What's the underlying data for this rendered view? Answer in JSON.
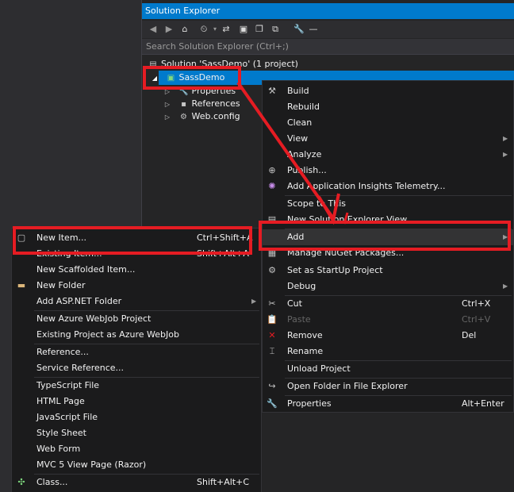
{
  "solution_explorer": {
    "title": "Solution Explorer",
    "search_placeholder": "Search Solution Explorer (Ctrl+;)",
    "toolbar_icons": [
      "back-icon",
      "forward-icon",
      "home-icon",
      "history-icon",
      "dropdown-icon",
      "sync-icon",
      "collapse-icon",
      "show-all-icon",
      "copy-icon",
      "wrench-icon",
      "pin-icon"
    ],
    "tree": {
      "solution": "Solution 'SassDemo' (1 project)",
      "project": "SassDemo",
      "children": [
        "Properties",
        "References",
        "Web.config"
      ]
    }
  },
  "context_menu": {
    "items": [
      {
        "label": "Build",
        "shortcut": "",
        "icon": "build-icon"
      },
      {
        "label": "Rebuild",
        "shortcut": "",
        "icon": ""
      },
      {
        "label": "Clean",
        "shortcut": "",
        "icon": ""
      },
      {
        "label": "View",
        "shortcut": "",
        "icon": "",
        "submenu": true
      },
      {
        "label": "Analyze",
        "shortcut": "",
        "icon": "",
        "submenu": true
      },
      {
        "label": "Publish...",
        "shortcut": "",
        "icon": "publish-icon"
      },
      {
        "label": "Add Application Insights Telemetry...",
        "shortcut": "",
        "icon": "insights-icon"
      },
      {
        "label": "Scope to This",
        "shortcut": "",
        "icon": ""
      },
      {
        "label": "New Solution Explorer View",
        "shortcut": "",
        "icon": "explorer-view-icon"
      },
      {
        "label": "Add",
        "shortcut": "",
        "icon": "",
        "submenu": true
      },
      {
        "label": "Manage NuGet Packages...",
        "shortcut": "",
        "icon": "nuget-icon"
      },
      {
        "label": "Set as StartUp Project",
        "shortcut": "",
        "icon": "gear-icon"
      },
      {
        "label": "Debug",
        "shortcut": "",
        "icon": "",
        "submenu": true
      },
      {
        "label": "Cut",
        "shortcut": "Ctrl+X",
        "icon": "cut-icon"
      },
      {
        "label": "Paste",
        "shortcut": "Ctrl+V",
        "icon": "paste-icon",
        "disabled": true
      },
      {
        "label": "Remove",
        "shortcut": "Del",
        "icon": "remove-icon"
      },
      {
        "label": "Rename",
        "shortcut": "",
        "icon": "rename-icon"
      },
      {
        "label": "Unload Project",
        "shortcut": "",
        "icon": ""
      },
      {
        "label": "Open Folder in File Explorer",
        "shortcut": "",
        "icon": "open-folder-icon"
      },
      {
        "label": "Properties",
        "shortcut": "Alt+Enter",
        "icon": "wrench-icon"
      }
    ]
  },
  "add_submenu": {
    "items": [
      {
        "label": "New Item...",
        "shortcut": "Ctrl+Shift+A",
        "icon": "new-item-icon"
      },
      {
        "label": "Existing Item...",
        "shortcut": "Shift+Alt+A",
        "icon": ""
      },
      {
        "label": "New Scaffolded Item...",
        "shortcut": "",
        "icon": ""
      },
      {
        "label": "New Folder",
        "shortcut": "",
        "icon": "folder-icon"
      },
      {
        "label": "Add ASP.NET Folder",
        "shortcut": "",
        "icon": "",
        "submenu": true
      },
      {
        "label": "New Azure WebJob Project",
        "shortcut": "",
        "icon": ""
      },
      {
        "label": "Existing Project as Azure WebJob",
        "shortcut": "",
        "icon": ""
      },
      {
        "label": "Reference...",
        "shortcut": "",
        "icon": ""
      },
      {
        "label": "Service Reference...",
        "shortcut": "",
        "icon": ""
      },
      {
        "label": "TypeScript File",
        "shortcut": "",
        "icon": ""
      },
      {
        "label": "HTML Page",
        "shortcut": "",
        "icon": ""
      },
      {
        "label": "JavaScript File",
        "shortcut": "",
        "icon": ""
      },
      {
        "label": "Style Sheet",
        "shortcut": "",
        "icon": ""
      },
      {
        "label": "Web Form",
        "shortcut": "",
        "icon": ""
      },
      {
        "label": "MVC 5 View Page (Razor)",
        "shortcut": "",
        "icon": ""
      },
      {
        "label": "Class...",
        "shortcut": "Shift+Alt+C",
        "icon": "class-icon"
      }
    ]
  },
  "colors": {
    "accent": "#007acc",
    "annotation": "#e51c23",
    "menu_bg": "#1b1b1c",
    "panel_bg": "#252526"
  }
}
